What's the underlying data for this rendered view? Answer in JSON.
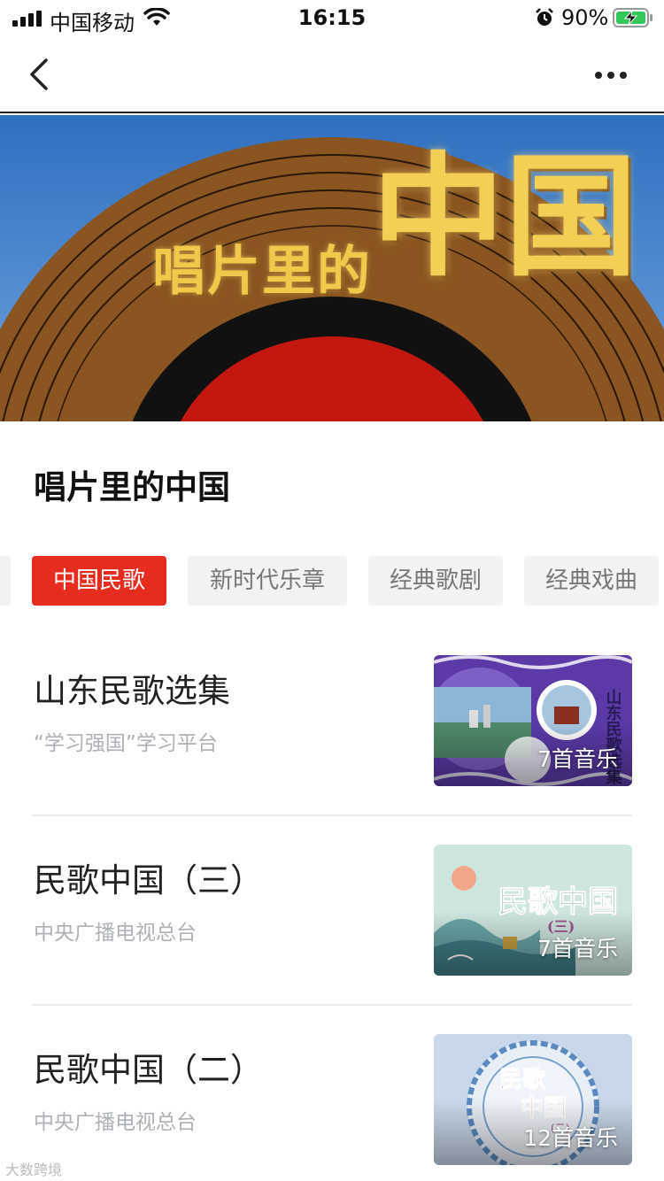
{
  "status_bar": {
    "carrier": "中国移动",
    "time": "16:15",
    "battery": "90%"
  },
  "nav": {
    "back_icon": "chevron-left-icon",
    "more_icon": "more-dots-icon"
  },
  "banner": {
    "title_small": "唱片里的",
    "title_large": "中国"
  },
  "page_title": "唱片里的中国",
  "tabs": [
    {
      "label": "中国民歌",
      "active": true
    },
    {
      "label": "新时代乐章",
      "active": false
    },
    {
      "label": "经典歌剧",
      "active": false
    },
    {
      "label": "经典戏曲",
      "active": false
    }
  ],
  "albums": [
    {
      "title": "山东民歌选集",
      "source": "“学习强国”学习平台",
      "count": "7首音乐",
      "thumb_text": "山东民歌选集"
    },
    {
      "title": "民歌中国（三）",
      "source": "中央广播电视总台",
      "count": "7首音乐",
      "thumb_text": "民歌中国",
      "thumb_sub": "(三)"
    },
    {
      "title": "民歌中国（二）",
      "source": "中央广播电视总台",
      "count": "12首音乐",
      "thumb_text": "民歌中国",
      "thumb_sub": "(二)"
    }
  ],
  "colors": {
    "accent": "#e62b1f",
    "tab_bg": "#f2f2f4",
    "subtitle": "#aeb1b6"
  },
  "watermark": "大数跨境"
}
